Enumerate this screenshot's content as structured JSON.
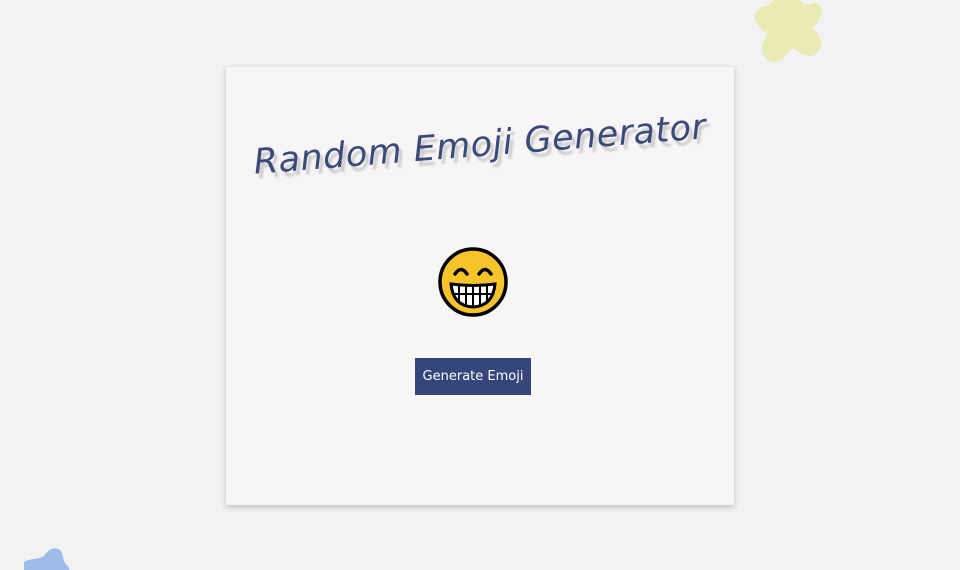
{
  "app": {
    "title": "Random Emoji Generator"
  },
  "emoji": {
    "current": "grinning-face-with-smiling-eyes",
    "face_color": "#f6c32b",
    "outline_color": "#000000"
  },
  "button": {
    "label": "Generate Emoji",
    "color": "#35467c"
  },
  "decor": {
    "blob_top_color": "#eaeab4",
    "blob_bottom_color": "#9ebbea",
    "card_color": "#f7f5f6",
    "background_color": "#f2f2f2",
    "title_color": "#3a4b7a"
  }
}
